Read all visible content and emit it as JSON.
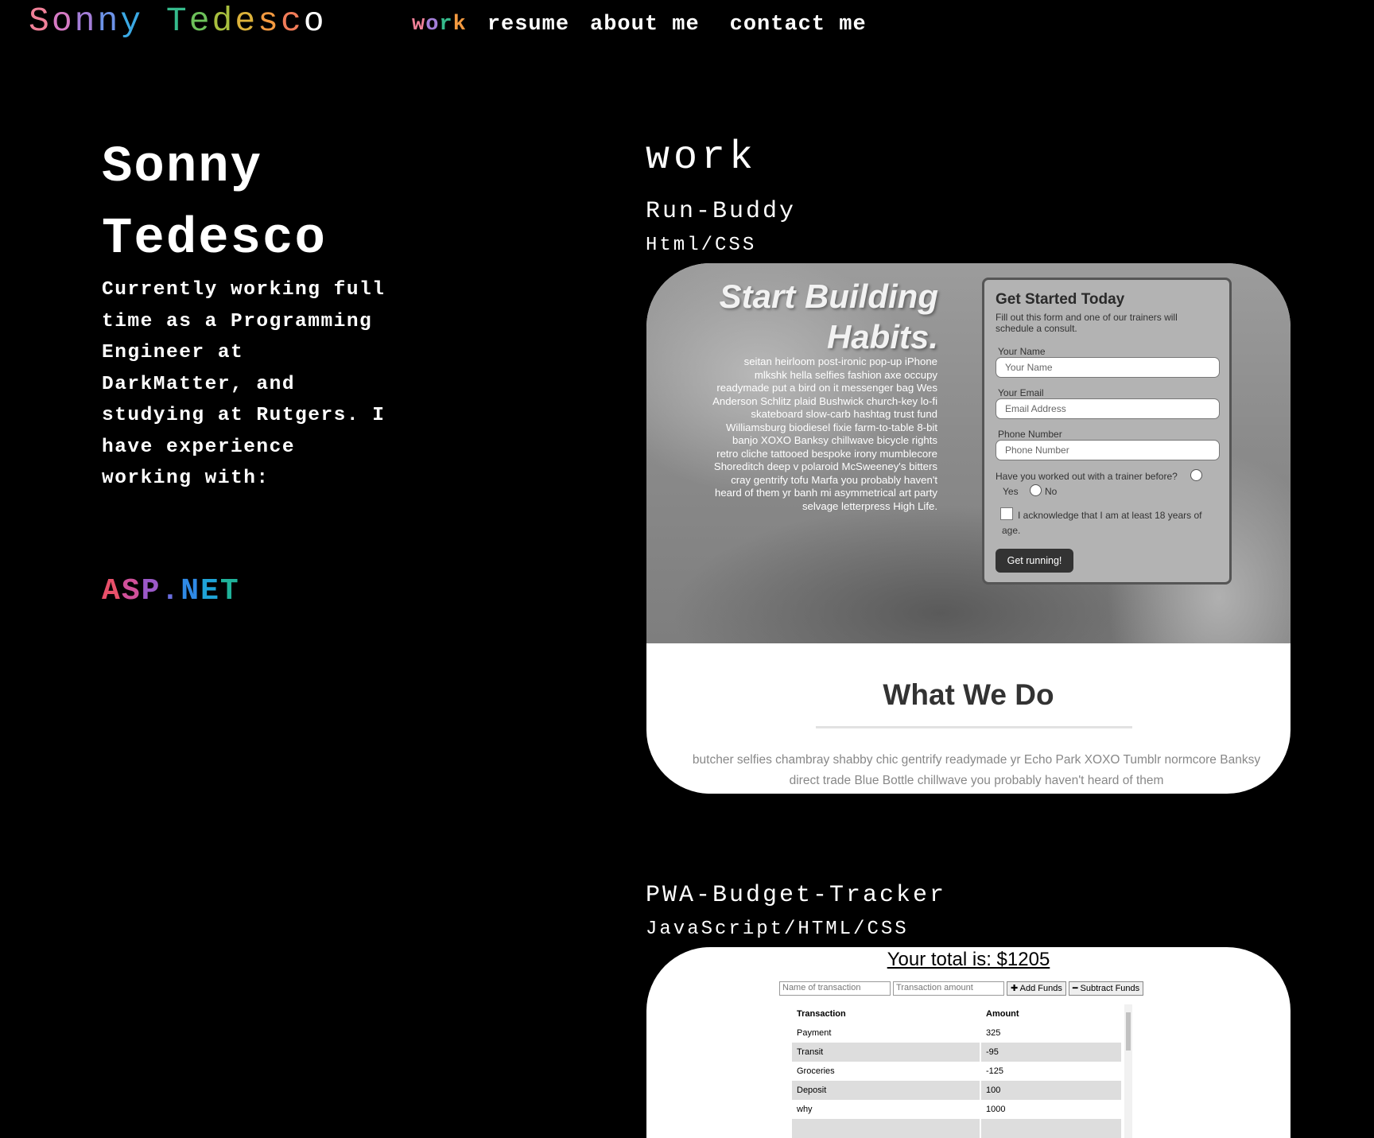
{
  "header": {
    "logo_chars": [
      "S",
      "o",
      "n",
      "n",
      "y",
      " ",
      "T",
      "e",
      "d",
      "e",
      "s",
      "c",
      "o"
    ],
    "nav": {
      "work_chars": [
        "w",
        "o",
        "r",
        "k"
      ],
      "resume": "resume",
      "about": "about me",
      "contact": "contact me"
    }
  },
  "hero": {
    "name_line1": "Sonny",
    "name_line2": "Tedesco",
    "bio": "Currently working full time as a Programming Engineer at DarkMatter, and studying at Rutgers. I have experience working with:",
    "skill_chars": [
      "A",
      "S",
      "P",
      ".",
      "N",
      "E",
      "T"
    ]
  },
  "work": {
    "title": "work",
    "projects": [
      {
        "name": "Run-Buddy",
        "tech": "Html/CSS",
        "screenshot": {
          "headline_1": "Start Building",
          "headline_2": "Habits.",
          "lorem": "seitan heirloom post-ironic pop-up iPhone mlkshk hella selfies fashion axe occupy readymade put a bird on it messenger bag Wes Anderson Schlitz plaid Bushwick church-key lo-fi skateboard slow-carb hashtag trust fund Williamsburg biodiesel fixie farm-to-table 8-bit banjo XOXO Banksy chillwave bicycle rights retro cliche tattooed bespoke irony mumblecore Shoreditch deep v polaroid McSweeney's bitters cray gentrify tofu Marfa you probably haven't heard of them yr banh mi asymmetrical art party selvage letterpress High Life.",
          "form_title": "Get Started Today",
          "form_sub": "Fill out this form and one of our trainers will schedule a consult.",
          "name_label": "Your Name",
          "name_placeholder": "Your Name",
          "email_label": "Your Email",
          "email_placeholder": "Email Address",
          "phone_label": "Phone Number",
          "phone_placeholder": "Phone Number",
          "question": "Have you worked out with a trainer before?",
          "yes": "Yes",
          "no": "No",
          "acknowledge": "I acknowledge that I am at least 18 years of age.",
          "button": "Get running!",
          "section_title": "What We Do",
          "section_text": "butcher selfies chambray shabby chic gentrify readymade yr Echo Park XOXO Tumblr normcore Banksy direct trade Blue Bottle chillwave you probably haven't heard of them"
        }
      },
      {
        "name": "PWA-Budget-Tracker",
        "tech": "JavaScript/HTML/CSS",
        "screenshot": {
          "total": "Your total is: $1205",
          "name_placeholder": "Name of transaction",
          "amount_placeholder": "Transaction amount",
          "add_button": "✚ Add Funds",
          "subtract_button": "━ Subtract Funds",
          "columns": [
            "Transaction",
            "Amount"
          ],
          "rows": [
            [
              "Payment",
              "325"
            ],
            [
              "Transit",
              "-95"
            ],
            [
              "Groceries",
              "-125"
            ],
            [
              "Deposit",
              "100"
            ],
            [
              "why",
              "1000"
            ]
          ]
        }
      }
    ]
  }
}
